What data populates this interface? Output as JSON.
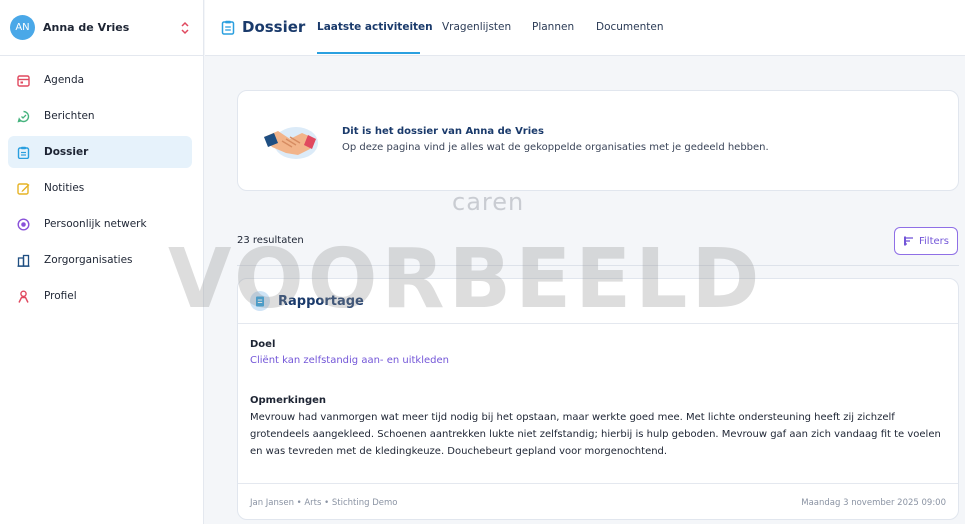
{
  "user": {
    "initials": "AN",
    "name": "Anna de Vries"
  },
  "sidebar": {
    "items": [
      {
        "label": "Agenda",
        "icon": "calendar-icon",
        "color": "#e0495f",
        "active": false
      },
      {
        "label": "Berichten",
        "icon": "chat-icon",
        "color": "#46b37e",
        "active": false
      },
      {
        "label": "Dossier",
        "icon": "clipboard-icon",
        "color": "#2a9fdf",
        "active": true
      },
      {
        "label": "Notities",
        "icon": "note-icon",
        "color": "#e6b325",
        "active": false
      },
      {
        "label": "Persoonlijk netwerk",
        "icon": "network-icon",
        "color": "#8a52d9",
        "active": false
      },
      {
        "label": "Zorgorganisaties",
        "icon": "building-icon",
        "color": "#1f4f82",
        "active": false
      },
      {
        "label": "Profiel",
        "icon": "person-icon",
        "color": "#e0495f",
        "active": false
      }
    ]
  },
  "header": {
    "title": "Dossier",
    "tabs": [
      {
        "label": "Laatste activiteiten",
        "active": true
      },
      {
        "label": "Vragenlijsten",
        "active": false
      },
      {
        "label": "Plannen",
        "active": false
      },
      {
        "label": "Documenten",
        "active": false
      }
    ]
  },
  "intro": {
    "title": "Dit is het dossier van Anna de Vries",
    "text": "Op deze pagina vind je alles wat de gekoppelde organisaties met je gedeeld hebben."
  },
  "watermark": {
    "brand": "caren",
    "text": "VOORBEELD"
  },
  "results": {
    "count_label": "23 resultaten",
    "filters_label": "Filters"
  },
  "report": {
    "title": "Rapportage",
    "goal_label": "Doel",
    "goal_value": "Cliënt kan zelfstandig aan- en uitkleden",
    "remarks_label": "Opmerkingen",
    "remarks_text": "Mevrouw had vanmorgen wat meer tijd nodig bij het opstaan, maar werkte goed mee. Met lichte ondersteuning heeft zij zichzelf grotendeels aangekleed. Schoenen aantrekken lukte niet zelfstandig; hierbij is hulp geboden. Mevrouw gaf aan zich vandaag fit te voelen en was tevreden met de kledingkeuze. Douchebeurt gepland voor morgenochtend.",
    "author": "Jan Jansen • Arts • Stichting Demo",
    "date": "Maandag 3 november 2025 09:00"
  },
  "colors": {
    "accent": "#2aa0e0",
    "purple": "#7356d8",
    "navy": "#1a3a6b"
  }
}
